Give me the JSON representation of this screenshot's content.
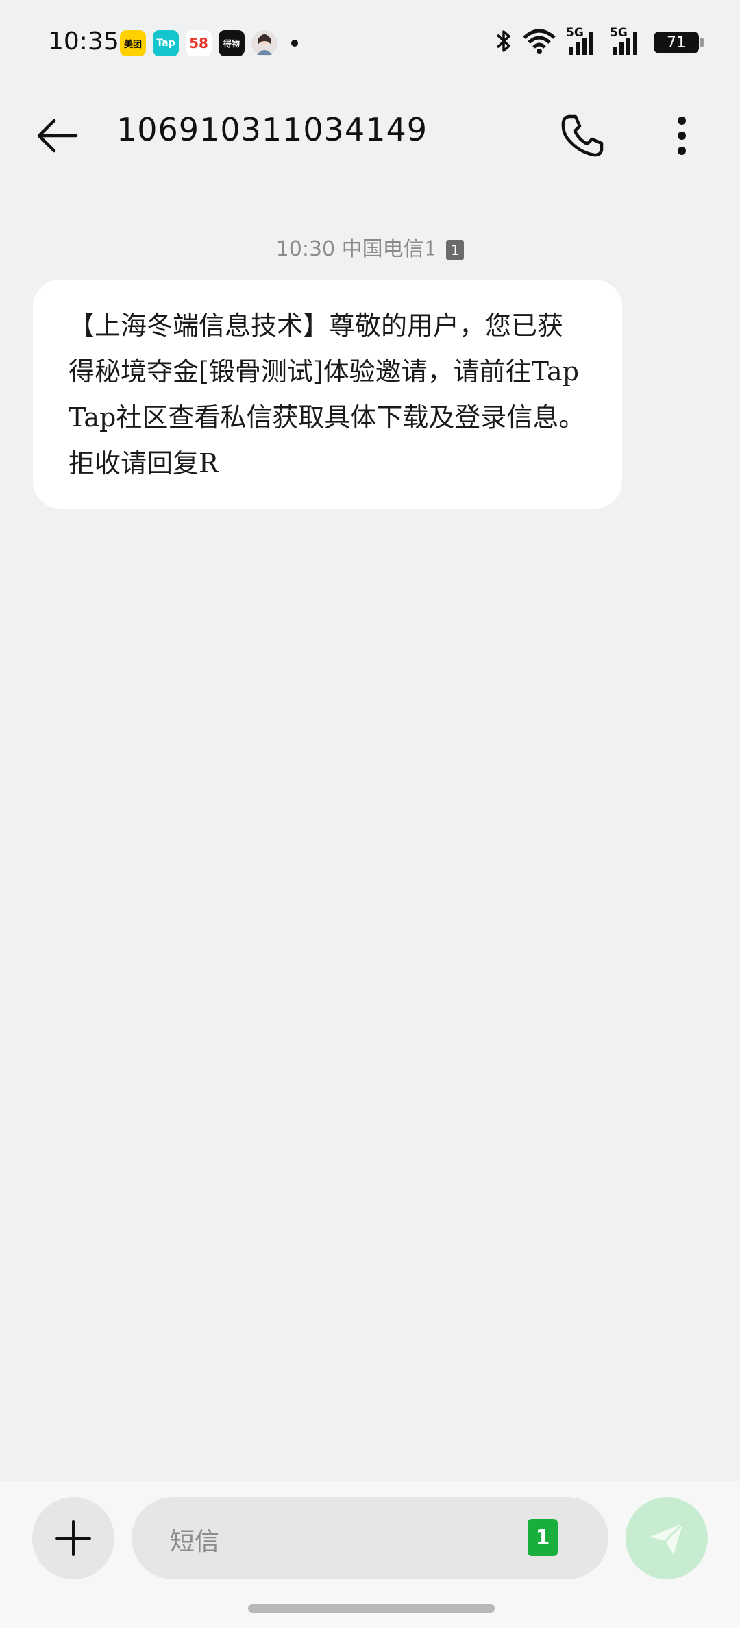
{
  "status_bar": {
    "time": "10:35",
    "notifications": [
      {
        "name": "meituan-icon",
        "label": "美团"
      },
      {
        "name": "taptap-icon",
        "label": "Tap"
      },
      {
        "name": "58-icon",
        "label": "58"
      },
      {
        "name": "dewu-icon",
        "label": "得物"
      },
      {
        "name": "avatar-icon",
        "label": ""
      }
    ],
    "network_1": "5G",
    "network_2": "5G",
    "battery": "71"
  },
  "header": {
    "contact": "106910311034149"
  },
  "thread": {
    "message": {
      "time": "10:30",
      "carrier": "中国电信1",
      "sim": "1",
      "text": "【上海冬端信息技术】尊敬的用户，您已获得秘境夺金[锻骨测试]体验邀请，请前往TapTap社区查看私信获取具体下载及登录信息。拒收请回复R"
    }
  },
  "composer": {
    "placeholder": "短信",
    "sim": "1"
  },
  "colors": {
    "background": "#f0f1f3",
    "bubble": "#ffffff",
    "sim_badge": "#1aae3c",
    "send_button": "#c8ecd0"
  }
}
